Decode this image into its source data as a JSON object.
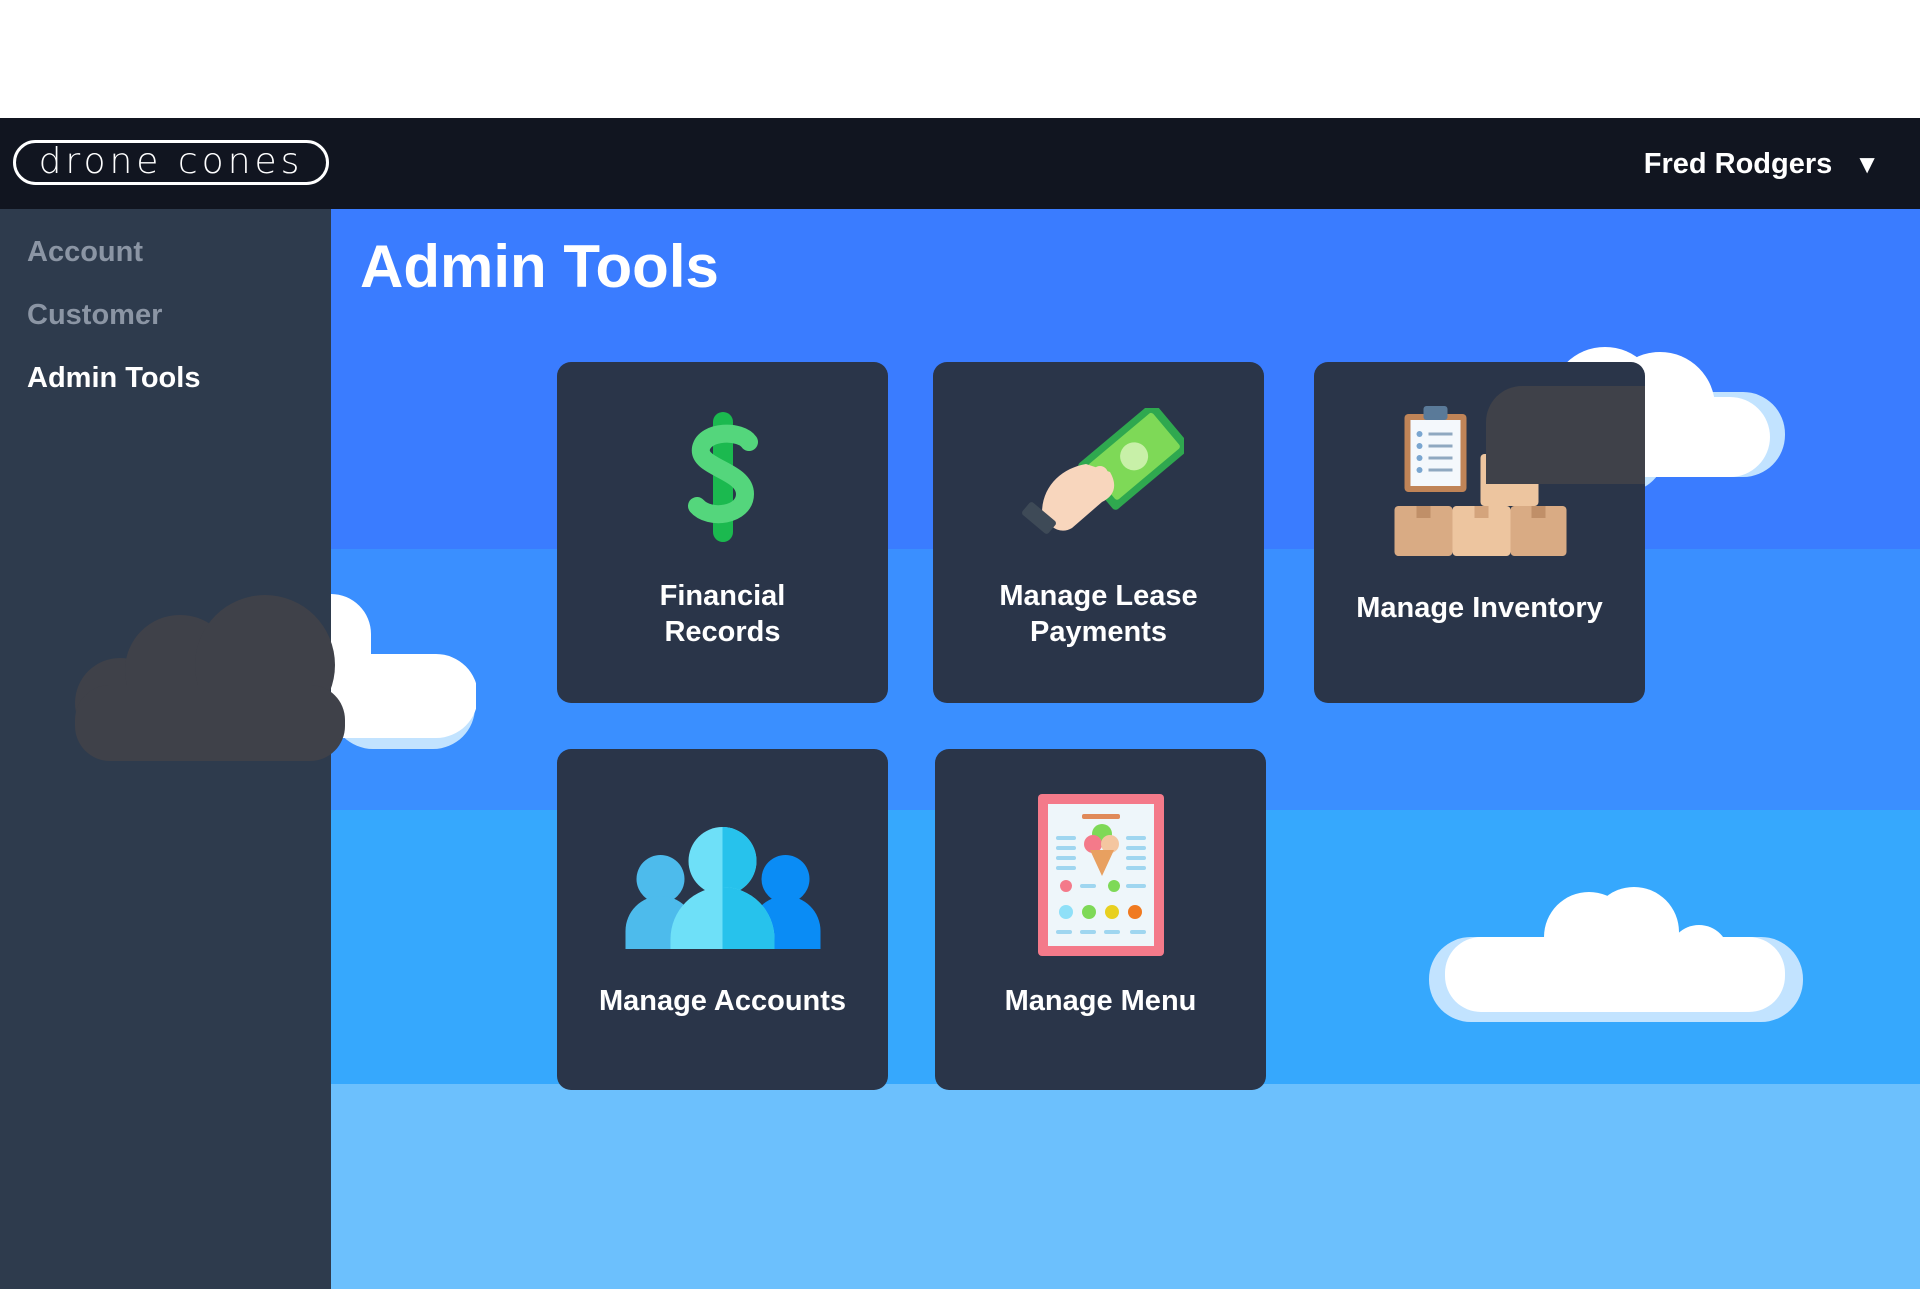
{
  "header": {
    "logo_text": "drone cones",
    "user_name": "Fred Rodgers",
    "caret": "▼"
  },
  "sidebar": {
    "items": [
      {
        "label": "Account",
        "active": false
      },
      {
        "label": "Customer",
        "active": false
      },
      {
        "label": "Admin Tools",
        "active": true
      }
    ]
  },
  "main": {
    "title": "Admin Tools",
    "tiles": [
      {
        "label": "Financial\nRecords",
        "icon": "dollar-sign-icon"
      },
      {
        "label": "Manage Lease\nPayments",
        "icon": "hand-money-icon"
      },
      {
        "label": "Manage Inventory",
        "icon": "inventory-boxes-icon"
      },
      {
        "label": "Manage Accounts",
        "icon": "users-group-icon"
      },
      {
        "label": "Manage Menu",
        "icon": "ice-cream-menu-icon"
      }
    ]
  },
  "colors": {
    "topbar": "#111520",
    "sidebar": "#2e3b4d",
    "tile": "#2a3549",
    "sky_1": "#3a7cff",
    "sky_2": "#3a8fff",
    "sky_3": "#36a8fd",
    "sky_4": "#6cc0fd",
    "cloud": "#ffffff",
    "cloud_shadow": "#c2e3ff"
  }
}
